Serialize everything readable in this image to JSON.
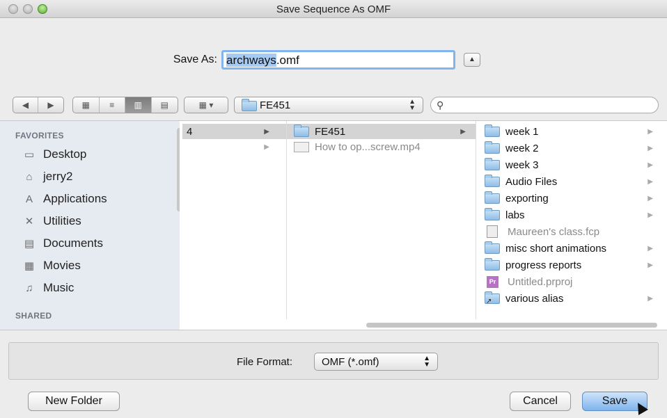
{
  "window": {
    "title": "Save Sequence As OMF"
  },
  "save_as": {
    "label": "Save As:",
    "filename_selected": "archways",
    "filename_ext": ".omf"
  },
  "toolbar": {
    "nav": [
      "◀",
      "▶"
    ],
    "views": [
      "▦",
      "≡",
      "▥",
      "▤"
    ],
    "arrange_icon": "▦ ▾",
    "location": "FE451",
    "search_placeholder": ""
  },
  "sidebar": {
    "favorites_header": "FAVORITES",
    "favorites": [
      {
        "label": "Desktop",
        "icon": "desktop-icon"
      },
      {
        "label": "jerry2",
        "icon": "home-icon"
      },
      {
        "label": "Applications",
        "icon": "applications-icon"
      },
      {
        "label": "Utilities",
        "icon": "utilities-icon"
      },
      {
        "label": "Documents",
        "icon": "documents-icon"
      },
      {
        "label": "Movies",
        "icon": "movies-icon"
      },
      {
        "label": "Music",
        "icon": "music-icon"
      }
    ],
    "shared_header": "SHARED"
  },
  "columns": {
    "col1": [
      {
        "label": "4",
        "selected": true
      }
    ],
    "col2": [
      {
        "label": "FE451",
        "selected": true,
        "type": "folder"
      },
      {
        "label": "How to op...screw.mp4",
        "selected": false,
        "type": "file"
      }
    ],
    "col3": [
      {
        "label": "week 1",
        "type": "folder"
      },
      {
        "label": "week 2",
        "type": "folder"
      },
      {
        "label": "week 3",
        "type": "folder"
      },
      {
        "label": "Audio Files",
        "type": "folder"
      },
      {
        "label": "exporting",
        "type": "folder"
      },
      {
        "label": "labs",
        "type": "folder"
      },
      {
        "label": "Maureen's class.fcp",
        "type": "fcp"
      },
      {
        "label": "misc short animations",
        "type": "folder"
      },
      {
        "label": "progress reports",
        "type": "folder"
      },
      {
        "label": "Untitled.prproj",
        "type": "prproj"
      },
      {
        "label": "various alias",
        "type": "alias"
      }
    ]
  },
  "options": {
    "file_format_label": "File Format:",
    "file_format_value": "OMF (*.omf)"
  },
  "buttons": {
    "new_folder": "New Folder",
    "cancel": "Cancel",
    "save": "Save"
  },
  "colors": {
    "selection_blue": "#a7caf3",
    "focus_ring": "#82b5ee",
    "default_button": "#7fb4ec",
    "sidebar_bg": "#e6ebf1"
  }
}
